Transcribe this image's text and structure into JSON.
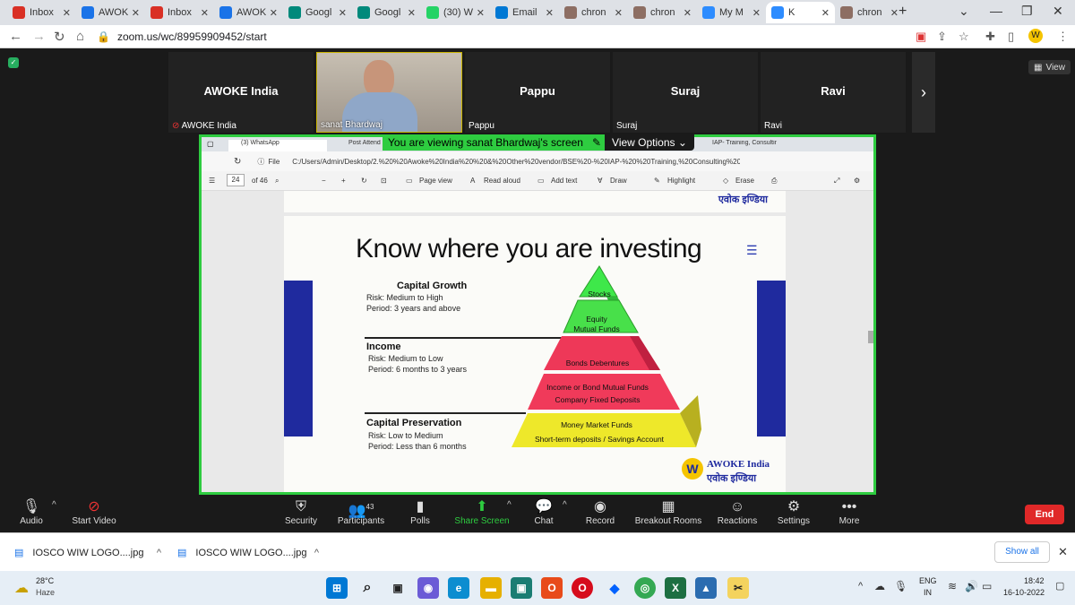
{
  "browser": {
    "tabs": [
      {
        "label": "Inbox",
        "icon": "gmail-icon",
        "color": "#d93025"
      },
      {
        "label": "AWOK",
        "icon": "calendar-icon",
        "color": "#1a73e8"
      },
      {
        "label": "Inbox",
        "icon": "gmail-icon",
        "color": "#d93025"
      },
      {
        "label": "AWOK",
        "icon": "calendar-icon",
        "color": "#1a73e8"
      },
      {
        "label": "Googl",
        "icon": "google-meet-icon",
        "color": "#00897b"
      },
      {
        "label": "Googl",
        "icon": "google-meet-icon",
        "color": "#00897b"
      },
      {
        "label": "(30) W",
        "icon": "whatsapp-icon",
        "color": "#25d366"
      },
      {
        "label": "Email",
        "icon": "outlook-icon",
        "color": "#0078d4"
      },
      {
        "label": "chron",
        "icon": "chron-icon",
        "color": "#8d6e63"
      },
      {
        "label": "chron",
        "icon": "chron-icon",
        "color": "#8d6e63"
      },
      {
        "label": "My M",
        "icon": "zoom-icon",
        "color": "#2d8cff"
      },
      {
        "label": "K",
        "icon": "zoom-icon",
        "color": "#2d8cff"
      },
      {
        "label": "chron",
        "icon": "chron-icon",
        "color": "#8d6e63"
      }
    ],
    "url": "zoom.us/wc/89959909452/start"
  },
  "zoom": {
    "view_label": "View",
    "participants": [
      {
        "name": "AWOKE India",
        "label": "AWOKE India"
      },
      {
        "name": "",
        "label": "sanat Bhardwaj"
      },
      {
        "name": "Pappu",
        "label": "Pappu"
      },
      {
        "name": "Suraj",
        "label": "Suraj"
      },
      {
        "name": "Ravi",
        "label": "Ravi"
      }
    ],
    "viewing_banner": "You are viewing sanat Bhardwaj's screen",
    "view_options": "View Options",
    "toolbar": [
      {
        "label": "Audio",
        "icon": "microphone-icon"
      },
      {
        "label": "Start Video",
        "icon": "video-off-icon"
      },
      {
        "label": "Security",
        "icon": "shield-icon"
      },
      {
        "label": "Participants",
        "icon": "participants-icon",
        "badge": "43"
      },
      {
        "label": "Polls",
        "icon": "polls-icon"
      },
      {
        "label": "Share Screen",
        "icon": "share-screen-icon"
      },
      {
        "label": "Chat",
        "icon": "chat-icon"
      },
      {
        "label": "Record",
        "icon": "record-icon"
      },
      {
        "label": "Breakout Rooms",
        "icon": "breakout-rooms-icon"
      },
      {
        "label": "Reactions",
        "icon": "reactions-icon"
      },
      {
        "label": "Settings",
        "icon": "gear-icon"
      },
      {
        "label": "More",
        "icon": "more-icon"
      }
    ],
    "end_label": "End"
  },
  "shared_screen": {
    "tabs": [
      "(3) WhatsApp",
      "Post Attend",
      "IAP- Training, Consultin"
    ],
    "file_label": "File",
    "path": "C:/Users/Admin/Desktop/2.%20%20Awoke%20India%20%20&%20Other%20vendor/BSE%20-%20IAP-%20%20Training,%20Consulting%20&%20...",
    "page_num": "24",
    "page_total": "of 46",
    "tools": [
      "Page view",
      "Read aloud",
      "Add text",
      "Draw",
      "Highlight",
      "Erase"
    ],
    "slide": {
      "title": "Know where you are investing",
      "sections": [
        {
          "heading": "Capital Growth",
          "risk": "Risk: Medium to High",
          "period": "Period: 3 years and above"
        },
        {
          "heading": "Income",
          "risk": "Risk: Medium to Low",
          "period": "Period: 6 months to 3 years"
        },
        {
          "heading": "Capital Preservation",
          "risk": "Risk: Low to Medium",
          "period": "Period: Less than 6 months"
        }
      ],
      "pyramid": [
        "Stocks",
        "Equity",
        "Mutual Funds",
        "Bonds Debentures",
        "Income or Bond Mutual Funds",
        "Company Fixed Deposits",
        "Money Market Funds",
        "Short-term deposits / Savings Account"
      ],
      "logo_en": "AWOKE India",
      "logo_hi": "एवोक इण्डिया"
    }
  },
  "downloads": {
    "items": [
      "IOSCO WIW LOGO....jpg",
      "IOSCO WIW LOGO....jpg"
    ],
    "show_all": "Show all"
  },
  "taskbar": {
    "weather_temp": "28°C",
    "weather_desc": "Haze",
    "lang": "ENG",
    "region": "IN",
    "time": "18:42",
    "date": "16-10-2022"
  }
}
